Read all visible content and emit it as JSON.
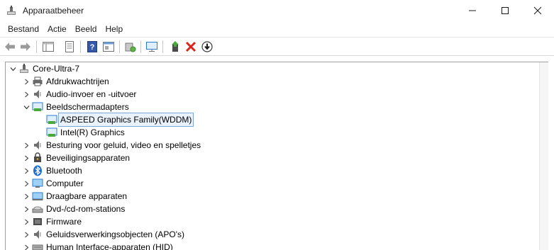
{
  "window": {
    "title": "Apparaatbeheer"
  },
  "menu": {
    "items": [
      "Bestand",
      "Actie",
      "Beeld",
      "Help"
    ]
  },
  "tree": {
    "root": "Core-Ultra-7",
    "items": [
      {
        "label": "Afdrukwachtrijen",
        "icon": "printer-icon",
        "expanded": false
      },
      {
        "label": "Audio-invoer en -uitvoer",
        "icon": "speaker-icon",
        "expanded": false
      },
      {
        "label": "Beeldschermadapters",
        "icon": "display-adapter-icon",
        "expanded": true,
        "children": [
          {
            "label": "ASPEED Graphics Family(WDDM)",
            "icon": "display-adapter-icon",
            "selected": true
          },
          {
            "label": "Intel(R) Graphics",
            "icon": "display-adapter-icon",
            "selected": false
          }
        ]
      },
      {
        "label": "Besturing voor geluid, video en spelletjes",
        "icon": "speaker-icon",
        "expanded": false
      },
      {
        "label": "Beveiligingsapparaten",
        "icon": "security-device-icon",
        "expanded": false
      },
      {
        "label": "Bluetooth",
        "icon": "bluetooth-icon",
        "expanded": false
      },
      {
        "label": "Computer",
        "icon": "computer-icon",
        "expanded": false
      },
      {
        "label": "Draagbare apparaten",
        "icon": "portable-device-icon",
        "expanded": false
      },
      {
        "label": "Dvd-/cd-rom-stations",
        "icon": "disc-drive-icon",
        "expanded": false
      },
      {
        "label": "Firmware",
        "icon": "firmware-icon",
        "expanded": false
      },
      {
        "label": "Geluidsverwerkingsobjecten (APO's)",
        "icon": "speaker-icon",
        "expanded": false
      },
      {
        "label": "Human Interface-apparaten (HID)",
        "icon": "hid-icon",
        "expanded": false
      }
    ]
  },
  "colors": {
    "selection_border": "#7aa7d8",
    "selection_fill": "#e9f1fb",
    "icon_blue": "#2b7bd4",
    "delete_red": "#d9261c"
  }
}
